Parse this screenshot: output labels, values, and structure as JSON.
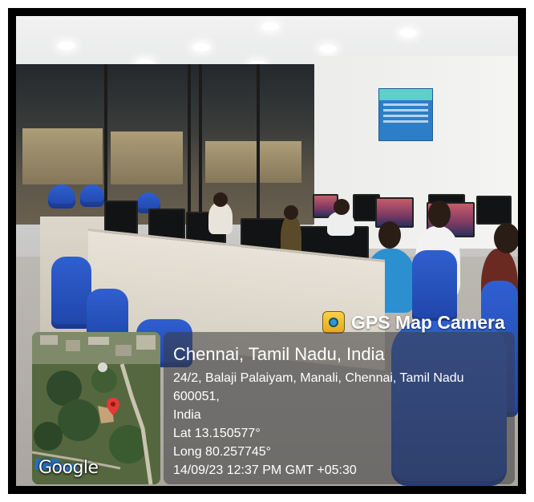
{
  "watermark": {
    "app_name": "GPS Map Camera",
    "app_icon": "camera-lens-icon",
    "map_provider": "Google",
    "place": "Chennai, Tamil Nadu, India",
    "address_line1": "24/2, Balaji Palaiyam, Manali, Chennai, Tamil Nadu 600051,",
    "address_line2": "India",
    "latitude": "Lat 13.150577°",
    "longitude": "Long 80.257745°",
    "datetime": "14/09/23 12:37 PM GMT +05:30"
  },
  "colors": {
    "chairs": "#2f5fd0",
    "poster": "#2e7ec7",
    "pin": "#e53935"
  }
}
